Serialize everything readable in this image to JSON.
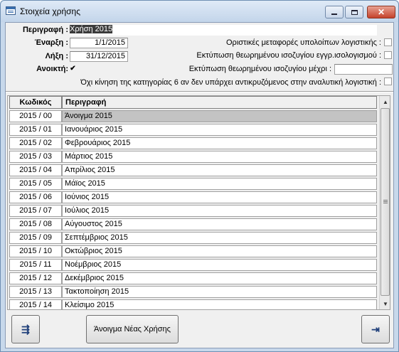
{
  "window": {
    "title": "Στοιχεία χρήσης",
    "app_icon": "form-icon"
  },
  "header": {
    "description_label": "Περιγραφή :",
    "description_value": "Χρήση 2015",
    "start_label": "Έναρξη :",
    "start_value": "1/1/2015",
    "end_label": "Λήξη :",
    "end_value": "31/12/2015",
    "open_label": "Ανοικτή:",
    "open_checked": true,
    "opt1_label": "Οριστικές μεταφορές υπολοίπων λογιστικής :",
    "opt1_checked": false,
    "opt2_label": "Εκτύπωση θεωρημένου ισοζυγίου εγγρ.ισολογισμού :",
    "opt2_checked": false,
    "opt3_label": "Εκτύπωση θεωρημένου ισοζυγίου μέχρι :",
    "opt3_value": "",
    "opt4_label": "Όχι κίνηση της κατηγορίας 6 αν δεν υπάρχει αντικρυζόμενος στην αναλυτική λογιστική :",
    "opt4_checked": false
  },
  "grid": {
    "columns": [
      "Κωδικός",
      "Περιγραφή"
    ],
    "rows": [
      {
        "code": "2015 / 00",
        "desc": "Άνοιγμα 2015",
        "selected": true
      },
      {
        "code": "2015 / 01",
        "desc": "Ιανουάριος 2015"
      },
      {
        "code": "2015 / 02",
        "desc": "Φεβρουάριος 2015"
      },
      {
        "code": "2015 / 03",
        "desc": "Μάρτιος 2015"
      },
      {
        "code": "2015 / 04",
        "desc": "Απρίλιος 2015"
      },
      {
        "code": "2015 / 05",
        "desc": "Μάϊος 2015"
      },
      {
        "code": "2015 / 06",
        "desc": "Ιούνιος 2015"
      },
      {
        "code": "2015 / 07",
        "desc": "Ιούλιος 2015"
      },
      {
        "code": "2015 / 08",
        "desc": "Αύγουστος 2015"
      },
      {
        "code": "2015 / 09",
        "desc": "Σεπτέμβριος 2015"
      },
      {
        "code": "2015 / 10",
        "desc": "Οκτώβριος 2015"
      },
      {
        "code": "2015 / 11",
        "desc": "Νοέμβριος 2015"
      },
      {
        "code": "2015 / 12",
        "desc": "Δεκέμβριος 2015"
      },
      {
        "code": "2015 / 13",
        "desc": "Τακτοποίηση 2015"
      },
      {
        "code": "2015 / 14",
        "desc": "Κλείσιμο 2015"
      }
    ]
  },
  "footer": {
    "filter_icon": "filter-icon",
    "new_year_label": "Άνοιγμα Νέας Χρήσης",
    "exit_icon": "exit-door-icon"
  }
}
